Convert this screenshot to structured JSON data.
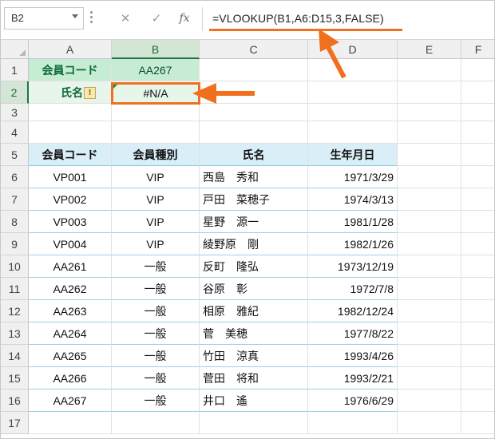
{
  "name_box": "B2",
  "formula_buttons": {
    "cancel": "✕",
    "confirm": "✓",
    "fx": "fx"
  },
  "formula": "=VLOOKUP(B1,A6:D15,3,FALSE)",
  "columns": [
    "A",
    "B",
    "C",
    "D",
    "E",
    "F"
  ],
  "rows": [
    "1",
    "2",
    "3",
    "4",
    "5",
    "6",
    "7",
    "8",
    "9",
    "10",
    "11",
    "12",
    "13",
    "14",
    "15",
    "16",
    "17"
  ],
  "row1": {
    "label": "会員コード",
    "value": "AA267"
  },
  "row2": {
    "label": "氏名",
    "value": "#N/A",
    "warn_icon": "!"
  },
  "table_headers": [
    "会員コード",
    "会員種別",
    "氏名",
    "生年月日"
  ],
  "table_rows": [
    [
      "VP001",
      "VIP",
      "西島　秀和",
      "1971/3/29"
    ],
    [
      "VP002",
      "VIP",
      "戸田　菜穂子",
      "1974/3/13"
    ],
    [
      "VP003",
      "VIP",
      "星野　源一",
      "1981/1/28"
    ],
    [
      "VP004",
      "VIP",
      "綾野原　剛",
      "1982/1/26"
    ],
    [
      "AA261",
      "一般",
      "反町　隆弘",
      "1973/12/19"
    ],
    [
      "AA262",
      "一般",
      "谷原　彰",
      "1972/7/8"
    ],
    [
      "AA263",
      "一般",
      "相原　雅紀",
      "1982/12/24"
    ],
    [
      "AA264",
      "一般",
      "菅　美穂",
      "1977/8/22"
    ],
    [
      "AA265",
      "一般",
      "竹田　涼真",
      "1993/4/26"
    ],
    [
      "AA266",
      "一般",
      "菅田　将和",
      "1993/2/21"
    ],
    [
      "AA267",
      "一般",
      "井口　遙",
      "1976/6/29"
    ]
  ],
  "colors": {
    "accent": "#f07020",
    "header_fill": "#d9eef7",
    "green_fill": "#c6ecd4"
  }
}
